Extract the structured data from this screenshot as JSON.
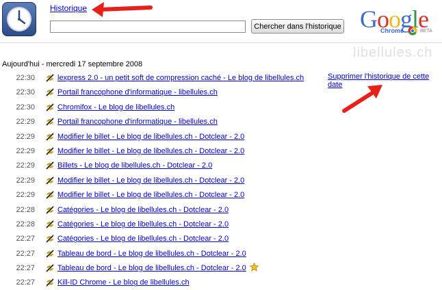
{
  "header": {
    "title": "Historique",
    "search_value": "",
    "search_button_label": "Chercher dans l'historique"
  },
  "logo": {
    "word": [
      "G",
      "o",
      "o",
      "g",
      "l",
      "e"
    ],
    "sub_label": "Chrome",
    "beta": "BETA"
  },
  "watermark": "libellules.ch",
  "date_heading": "Aujourd'hui - mercredi 17 septembre 2008",
  "delete_link": "Supprimer l'historique de cette date",
  "colors": {
    "link": "#0000cc",
    "arrow": "#e8201a",
    "star": "#f3c21a"
  },
  "icons": {
    "app": "history-clock-icon",
    "favicon": "dragonfly-favicon-icon",
    "starred": "star-icon"
  },
  "history": [
    {
      "time": "22:30",
      "title": "lexpress 2.0 - un petit soft de compression caché - Le blog de libellules.ch",
      "starred": false
    },
    {
      "time": "22:30",
      "title": "Portail francophone d'informatique - libellules.ch",
      "starred": false
    },
    {
      "time": "22:30",
      "title": "Chromifox - Le blog de libellules.ch",
      "starred": false
    },
    {
      "time": "22:29",
      "title": "Portail francophone d'informatique - libellules.ch",
      "starred": false
    },
    {
      "time": "22:29",
      "title": "Modifier le billet - Le blog de libellules.ch - Dotclear - 2.0",
      "starred": false
    },
    {
      "time": "22:29",
      "title": "Modifier le billet - Le blog de libellules.ch - Dotclear - 2.0",
      "starred": false
    },
    {
      "time": "22:29",
      "title": "Billets - Le blog de libellules.ch - Dotclear - 2.0",
      "starred": false
    },
    {
      "time": "22:29",
      "title": "Modifier le billet - Le blog de libellules.ch - Dotclear - 2.0",
      "starred": false
    },
    {
      "time": "22:29",
      "title": "Modifier le billet - Le blog de libellules.ch - Dotclear - 2.0",
      "starred": false
    },
    {
      "time": "22:28",
      "title": "Catégories - Le blog de libellules.ch - Dotclear - 2.0",
      "starred": false
    },
    {
      "time": "22:28",
      "title": "Catégories - Le blog de libellules.ch - Dotclear - 2.0",
      "starred": false
    },
    {
      "time": "22:27",
      "title": "Catégories - Le blog de libellules.ch - Dotclear - 2.0",
      "starred": false
    },
    {
      "time": "22:27",
      "title": "Tableau de bord - Le blog de libellules.ch - Dotclear - 2.0",
      "starred": false
    },
    {
      "time": "22:27",
      "title": "Tableau de bord - Le blog de libellules.ch - Dotclear - 2.0",
      "starred": true
    },
    {
      "time": "22:27",
      "title": "Kill-ID Chrome - Le blog de libellules.ch",
      "starred": false
    }
  ]
}
